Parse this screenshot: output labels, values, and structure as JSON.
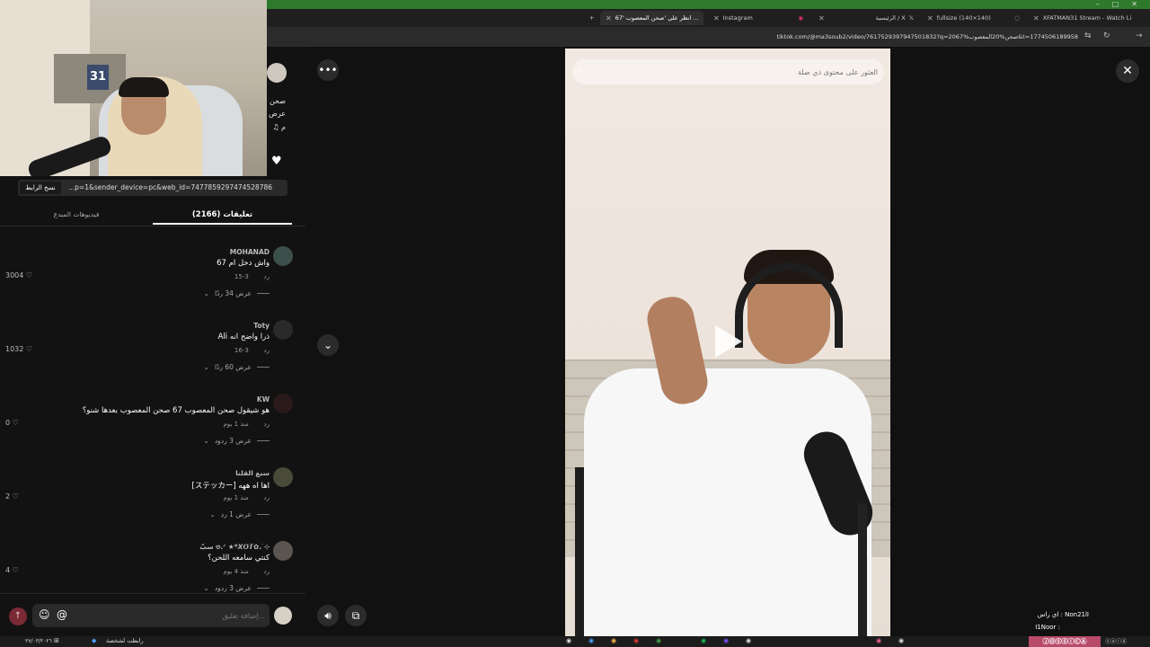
{
  "window_controls": [
    "–",
    "□",
    "✕"
  ],
  "tabs": [
    {
      "label": "انظر على 'صحن المعصوب '67 ...",
      "active": true
    },
    {
      "label": "Instagram",
      "active": false
    },
    {
      "label": "الرئيسية / X",
      "active": false
    },
    {
      "label": "fullsize (140×140)",
      "active": false
    },
    {
      "label": "XFATMAN31 Stream - Watch Li",
      "active": false
    }
  ],
  "address_bar": {
    "url": "tiktok.com/@ma3soub2/video/7617529397947501832?q=صحن%20المعصوب%2067&t=1774506189958"
  },
  "webcam": {
    "badge": "31"
  },
  "post_header": {
    "line1": "صحن",
    "line2": "عرض",
    "line3": "♫ م"
  },
  "link_row": {
    "copy_label": "نسخ الرابط",
    "link_text": "...p=1&sender_device=pc&web_id=7477859297474528786"
  },
  "panel_tabs": {
    "comments": "تعليقات (2166)",
    "creator_videos": "فيديوهات المبدع"
  },
  "comments": [
    {
      "user": "MOHANAD",
      "text": "واش دخل ام 67",
      "date": "3-15",
      "reply": "رد",
      "likes": "3004",
      "view_replies": "عرض 34 ردًا"
    },
    {
      "user": "Toty",
      "text": "Ali ذرا واضح انه",
      "date": "3-16",
      "reply": "رد",
      "likes": "1032",
      "view_replies": "عرض 60 ردًا"
    },
    {
      "user": "KW",
      "text": "هو شيقول صحن المعصوب 67 صحن المعصوب بعدها شنو؟",
      "date": "منذ 1 يوم",
      "reply": "رد",
      "likes": "0",
      "view_replies": "عرض 3 ردود"
    },
    {
      "user": "سبع القلنا",
      "text": "[ステッカー] اها اه ههه",
      "date": "منذ 1 يوم",
      "reply": "رد",
      "likes": "2",
      "view_replies": "عرض 1 رد"
    },
    {
      "user": "سبّ 𖹭.ᐟ ★꙳𝙓𝙊𝙏✿.࣪ ⊹",
      "text": "كنتي سامعه اللحن؟",
      "date": "منذ 4 يوم",
      "reply": "رد",
      "likes": "4",
      "view_replies": "عرض 3 ردود"
    }
  ],
  "compose": {
    "placeholder": "إضافة تعليق..."
  },
  "video": {
    "search_placeholder": "العثور على محتوى ذي صلة"
  },
  "chat": [
    {
      "text": "اي راس : Non21lI"
    },
    {
      "text": "I1Noor :"
    }
  ],
  "taskbar": {
    "clock": "٢٧/٠٣/٢٠٢٦",
    "app_label": "رابطت لشخصة",
    "banner": "ⒿⓄⓈⓈⒾⒸⒶ",
    "right_label": "ⓢⓐⓡⓓ"
  },
  "icons": {
    "more": "more-icon",
    "close": "close-icon",
    "scroll_down": "chevron-down-icon",
    "volume": "volume-icon",
    "pip": "pip-icon",
    "search": "search-icon",
    "heart": "heart-icon",
    "emoji": "emoji-icon",
    "mention": "at-icon",
    "send": "send-icon"
  },
  "colors": {
    "accent": "#fe2c55",
    "green_bar": "#2d7a2b",
    "banner": "#b84a6a"
  }
}
